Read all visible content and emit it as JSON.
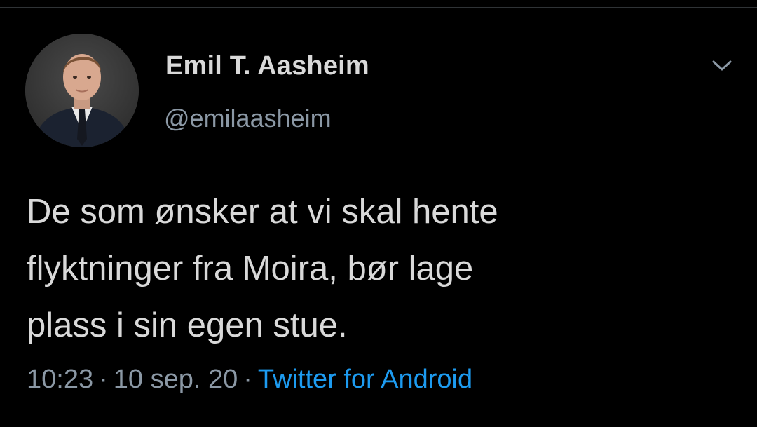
{
  "author": {
    "display_name": "Emil T. Aasheim",
    "handle": "@emilaasheim"
  },
  "tweet": {
    "text": "De som ønsker at vi skal hente\nflyktninger fra Moira, bør lage\nplass i sin egen stue."
  },
  "meta": {
    "time": "10:23",
    "separator": "·",
    "date": "10 sep. 20",
    "source": "Twitter for Android"
  },
  "icons": {
    "menu": "chevron-down-icon",
    "avatar": "profile-photo"
  },
  "colors": {
    "background": "#000000",
    "text": "#d9d9d9",
    "secondary": "#8b98a5",
    "link": "#1d9bf0"
  }
}
